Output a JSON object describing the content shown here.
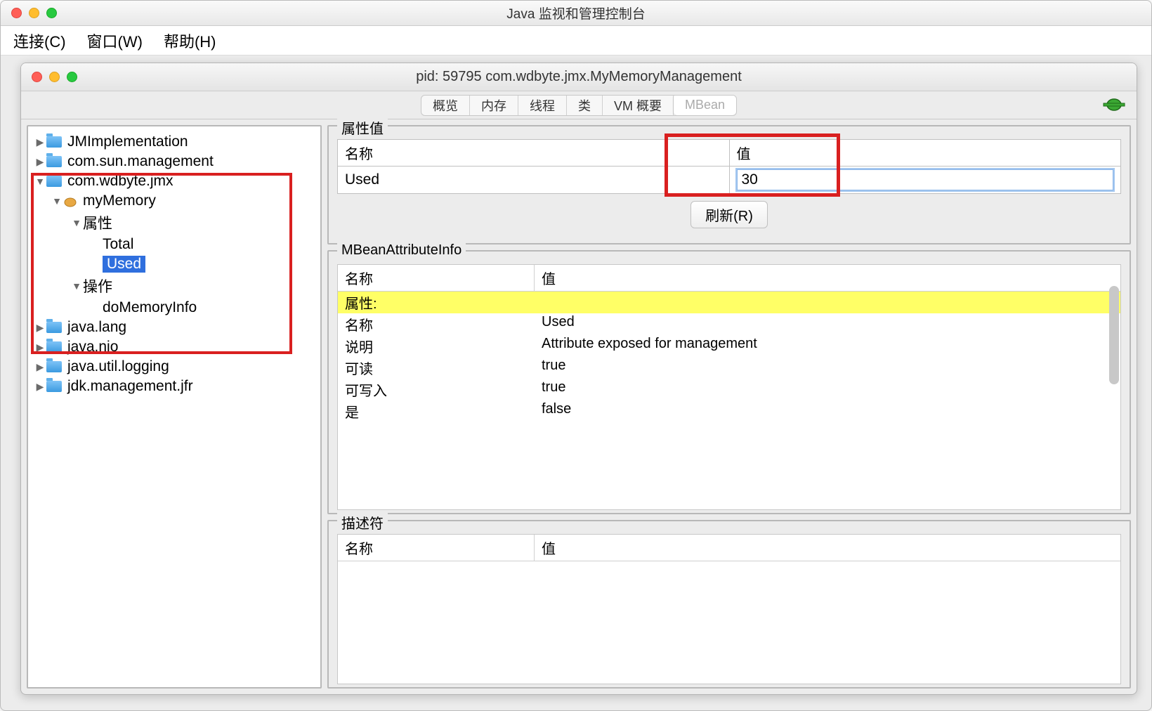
{
  "window": {
    "title": "Java 监视和管理控制台"
  },
  "menu": {
    "connect": "连接(C)",
    "window": "窗口(W)",
    "help": "帮助(H)"
  },
  "inner": {
    "title": "pid: 59795 com.wdbyte.jmx.MyMemoryManagement"
  },
  "tabs": {
    "overview": "概览",
    "memory": "内存",
    "threads": "线程",
    "classes": "类",
    "vmsummary": "VM 概要",
    "mbean": "MBean"
  },
  "tree": {
    "jmimpl": "JMImplementation",
    "sunmgmt": "com.sun.management",
    "wdbyte": "com.wdbyte.jmx",
    "mymemory": "myMemory",
    "attrs": "属性",
    "total": "Total",
    "used": "Used",
    "ops": "操作",
    "domemory": "doMemoryInfo",
    "javalang": "java.lang",
    "javanio": "java.nio",
    "javalog": "java.util.logging",
    "jdkmgmt": "jdk.management.jfr"
  },
  "attrval": {
    "legend": "属性值",
    "name_hdr": "名称",
    "val_hdr": "值",
    "name": "Used",
    "value": "30",
    "refresh": "刷新(R)"
  },
  "info": {
    "legend": "MBeanAttributeInfo",
    "name_hdr": "名称",
    "val_hdr": "值",
    "rows": {
      "attr_label": "属性:",
      "name_k": "名称",
      "name_v": "Used",
      "desc_k": "说明",
      "desc_v": "Attribute exposed for management",
      "read_k": "可读",
      "read_v": "true",
      "write_k": "可写入",
      "write_v": "true",
      "is_k": "是",
      "is_v": "false"
    }
  },
  "desc": {
    "legend": "描述符",
    "name_hdr": "名称",
    "val_hdr": "值"
  }
}
